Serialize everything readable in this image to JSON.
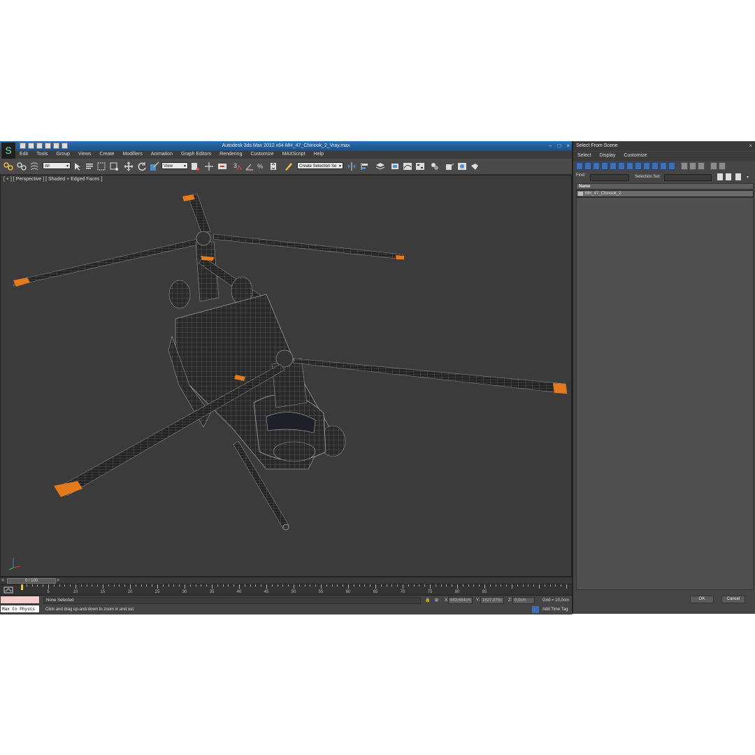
{
  "window": {
    "title": "Autodesk 3ds Max  2012 x64     MH_47_Chinook_2_Vray.max",
    "icons": [
      "new-icon",
      "open-icon",
      "save-icon",
      "undo-icon",
      "redo-icon",
      "project-icon"
    ]
  },
  "menu": [
    "Edit",
    "Tools",
    "Group",
    "Views",
    "Create",
    "Modifiers",
    "Animation",
    "Graph Editors",
    "Rendering",
    "Customize",
    "MAXScript",
    "Help"
  ],
  "toolbar": {
    "selection_filter": "All",
    "ref_coord": "View",
    "named_selection": "Create Selection Se",
    "snap_labels": [
      "3",
      "%"
    ]
  },
  "viewport": {
    "label": "[ + ] [ Perspective ] [ Shaded + Edged Faces ]",
    "object_accent": "#e47a1e"
  },
  "timeslider": {
    "position": "0 / 100",
    "prev": "<",
    "next": ">"
  },
  "trackbar": {
    "ticks": [
      "5",
      "10",
      "15",
      "20",
      "25",
      "30",
      "35",
      "40",
      "45",
      "50",
      "55",
      "60",
      "65",
      "70",
      "75",
      "80",
      "85"
    ]
  },
  "status": {
    "maxscript_listener": "Max to Physcs",
    "selection": "None Selected",
    "prompt": "Click and drag up-and-down to zoom in and out",
    "x_label": "X:",
    "x_value": "843,664cm",
    "y_label": "Y:",
    "y_value": "1627,875c",
    "z_label": "Z:",
    "z_value": "0,0cm",
    "grid": "Grid = 10,0cm",
    "add_time_tag": "Add Time Tag"
  },
  "panel": {
    "title": "Select From Scene",
    "close": "×",
    "menu": [
      "Select",
      "Display",
      "Customize"
    ],
    "find_label": "Find:",
    "selection_set_label": "Selection Set:",
    "column_header": "Name",
    "items": [
      "MH_47_Chinook_2"
    ],
    "ok": "OK",
    "cancel": "Cancel"
  }
}
